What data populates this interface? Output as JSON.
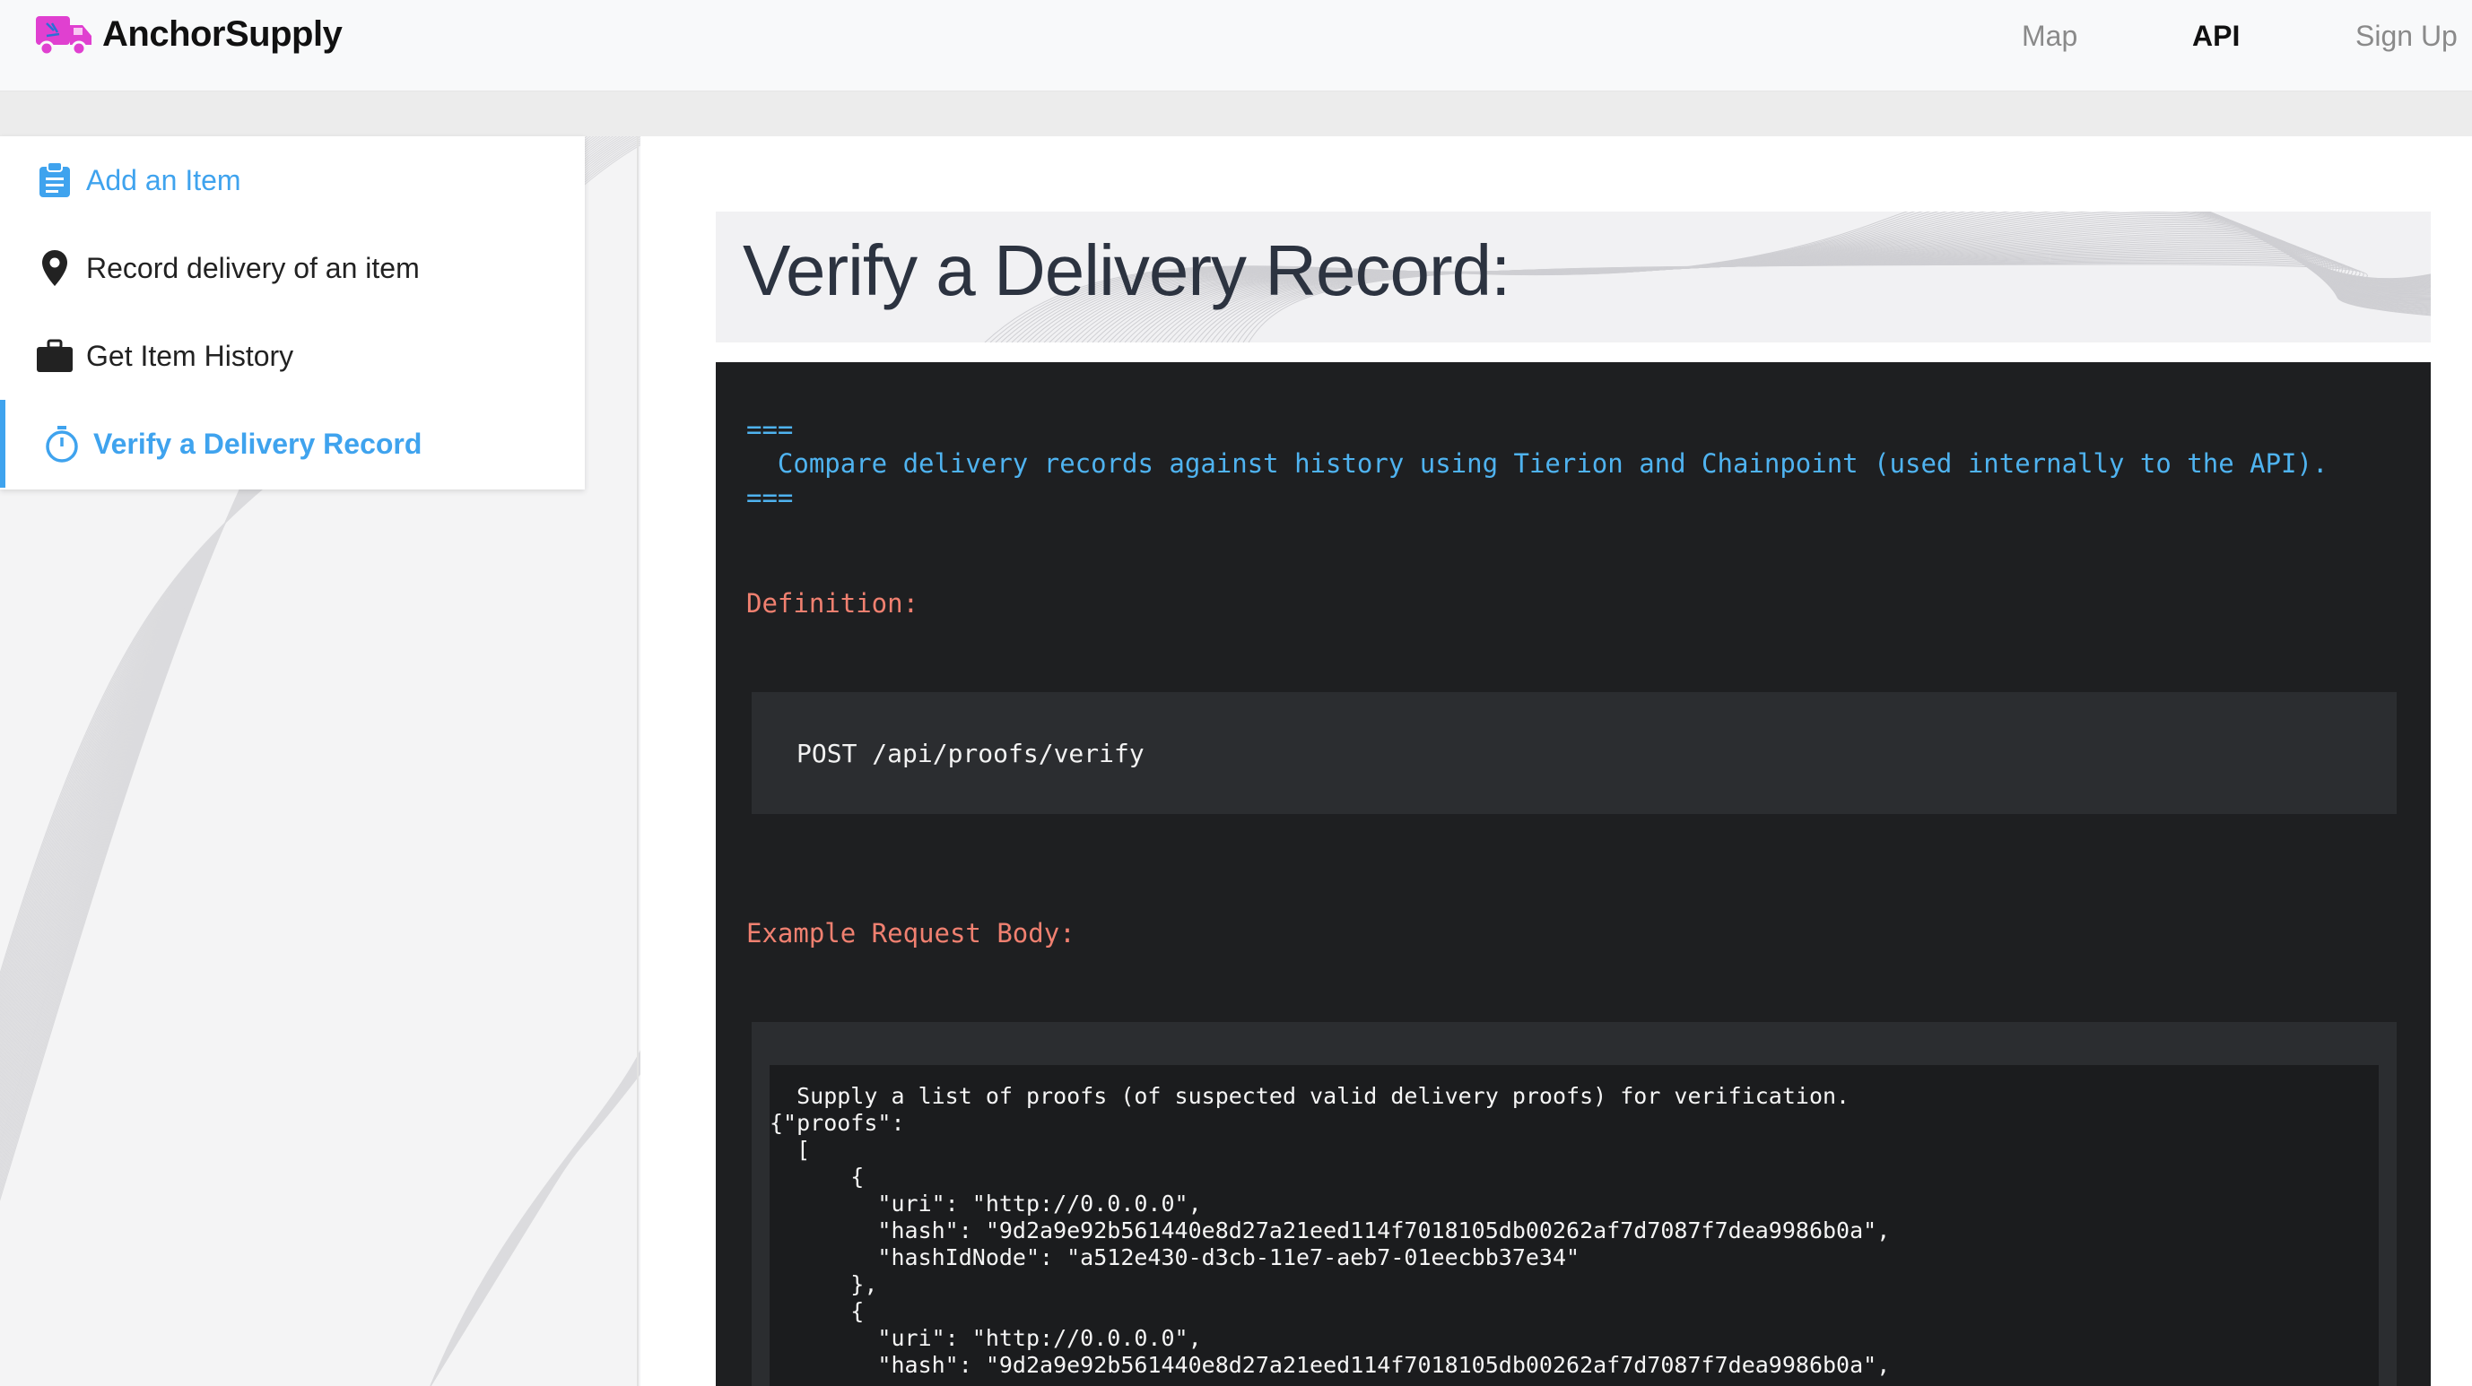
{
  "brand": {
    "name": "AnchorSupply",
    "logo_icon": "delivery-truck-icon",
    "logo_color": "#e040d0"
  },
  "nav": {
    "map": "Map",
    "api": "API",
    "signup": "Sign Up"
  },
  "sidebar": {
    "items": [
      {
        "label": "Add an Item",
        "icon": "clipboard-icon"
      },
      {
        "label": "Record delivery of an item",
        "icon": "map-pin-icon"
      },
      {
        "label": "Get Item History",
        "icon": "briefcase-icon"
      },
      {
        "label": "Verify a Delivery Record",
        "icon": "stopwatch-icon"
      }
    ],
    "active_index": 3
  },
  "main": {
    "title": "Verify a Delivery Record:",
    "intro_separator": "===",
    "intro_text": "  Compare delivery records against history using Tierion and Chainpoint (used internally to the API).",
    "definition_label": "Definition:",
    "definition_code": "POST /api/proofs/verify",
    "example_label": "Example Request Body:",
    "example_code": "  Supply a list of proofs (of suspected valid delivery proofs) for verification.\n{\"proofs\":\n  [\n      {\n        \"uri\": \"http://0.0.0.0\",\n        \"hash\": \"9d2a9e92b561440e8d27a21eed114f7018105db00262af7d7087f7dea9986b0a\",\n        \"hashIdNode\": \"a512e430-d3cb-11e7-aeb7-01eecbb37e34\"\n      },\n      {\n        \"uri\": \"http://0.0.0.0\",\n        \"hash\": \"9d2a9e92b561440e8d27a21eed114f7018105db00262af7d7087f7dea9986b0a\","
  },
  "colors": {
    "accent": "#3fa3ee",
    "code_bg": "#1e1f21",
    "label": "#f08070",
    "comment": "#4fb3f0"
  }
}
